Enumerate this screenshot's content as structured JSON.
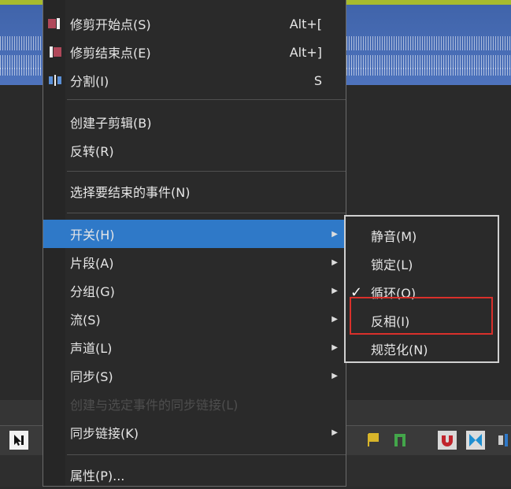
{
  "context_menu": {
    "items": [
      {
        "label": "修剪开始点(S)",
        "accel": "Alt+["
      },
      {
        "label": "修剪结束点(E)",
        "accel": "Alt+]"
      },
      {
        "label": "分割(I)",
        "accel": "S"
      },
      {
        "label": "创建子剪辑(B)"
      },
      {
        "label": "反转(R)"
      },
      {
        "label": "选择要结束的事件(N)"
      },
      {
        "label": "开关(H)"
      },
      {
        "label": "片段(A)"
      },
      {
        "label": "分组(G)"
      },
      {
        "label": "流(S)"
      },
      {
        "label": "声道(L)"
      },
      {
        "label": "同步(S)"
      },
      {
        "label": "创建与选定事件的同步链接(L)"
      },
      {
        "label": "同步链接(K)"
      },
      {
        "label": "属性(P)..."
      }
    ]
  },
  "switch_submenu": {
    "items": [
      {
        "label": "静音(M)"
      },
      {
        "label": "锁定(L)"
      },
      {
        "label": "循环(O)",
        "checked": "✓"
      },
      {
        "label": "反相(I)"
      },
      {
        "label": "规范化(N)"
      }
    ]
  },
  "colors": {
    "highlight": "#2f79c8",
    "callout": "#d9302b",
    "waveform": "#4e73bd"
  }
}
